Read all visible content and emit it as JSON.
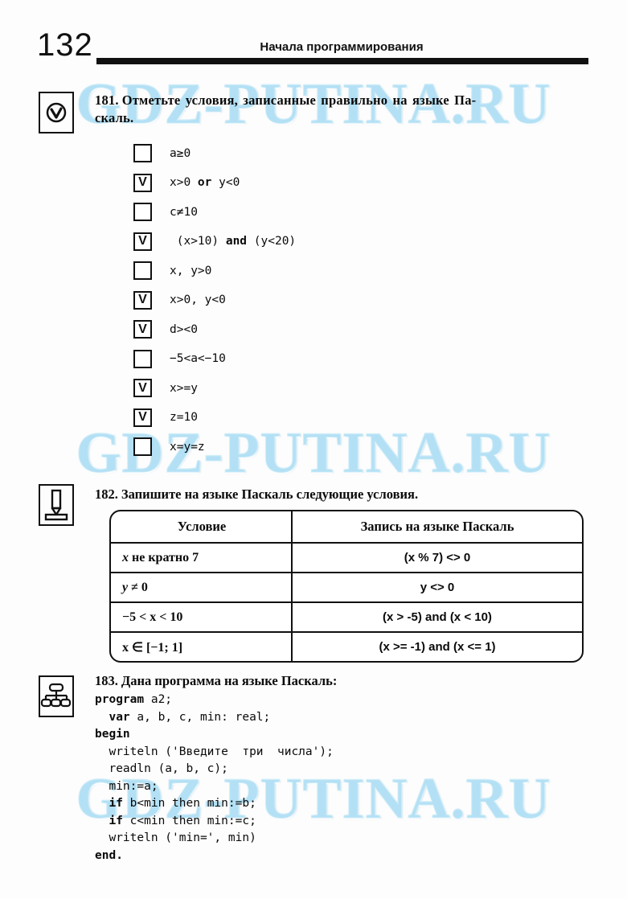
{
  "header": {
    "page_number": "132",
    "running_head": "Начала программирования"
  },
  "watermark": {
    "text": "GDZ-PUTINA.RU",
    "color": "#9fd8f2"
  },
  "icons": {
    "check_icon_name": "check-circle-icon",
    "pencil_icon_name": "pencil-icon",
    "tree_icon_name": "hierarchy-tree-icon"
  },
  "exercise_181": {
    "number": "181.",
    "prompt_line_1": "Отметьте условия, записанные правильно на языке Па-",
    "prompt_line_2": "скаль.",
    "options": [
      {
        "checked": false,
        "text": "a≥0"
      },
      {
        "checked": true,
        "text": "x>0 or y<0",
        "pre": "x>0 ",
        "bold": "or",
        "post": " y<0"
      },
      {
        "checked": false,
        "text": "c≠10"
      },
      {
        "checked": true,
        "text": "(x>10) and (y<20)",
        "pre": " (x>10) ",
        "bold": "and",
        "post": " (y<20)"
      },
      {
        "checked": false,
        "text": "x, y>0"
      },
      {
        "checked": true,
        "text": "x>0, y<0"
      },
      {
        "checked": true,
        "text": "d><0"
      },
      {
        "checked": false,
        "text": "−5<a<−10"
      },
      {
        "checked": true,
        "text": "x>=y"
      },
      {
        "checked": true,
        "text": "z=10"
      },
      {
        "checked": false,
        "text": "x=y=z"
      }
    ]
  },
  "exercise_182": {
    "number": "182.",
    "prompt": "Запишите на языке Паскаль следующие условия.",
    "table": {
      "headers": [
        "Условие",
        "Запись на языке Паскаль"
      ],
      "rows": [
        {
          "condition_italic": "x",
          "condition_rest": " не кратно 7",
          "pascal": "(x % 7) <> 0"
        },
        {
          "condition_italic": "y",
          "condition_rest": " ≠ 0",
          "pascal": "y <> 0"
        },
        {
          "condition_italic": "",
          "condition_rest": "−5 < x < 10",
          "pascal": "(x > -5) and (x < 10)"
        },
        {
          "condition_italic": "",
          "condition_rest": "x ∈ [−1; 1]",
          "pascal": "(x >= -1) and (x <= 1)"
        }
      ]
    }
  },
  "exercise_183": {
    "number": "183.",
    "prompt": "Дана программа на языке Паскаль:",
    "code_lines": [
      {
        "kw": "program",
        "rest": " a2;",
        "indent": ""
      },
      {
        "kw": "var",
        "rest": " a, b, c, min: real;",
        "indent": "  "
      },
      {
        "kw": "begin",
        "rest": "",
        "indent": ""
      },
      {
        "kw": "",
        "rest": "writeln ('Введите  три  числа');",
        "indent": "  "
      },
      {
        "kw": "",
        "rest": "readln (a, b, c);",
        "indent": "  "
      },
      {
        "kw": "",
        "rest": "min:=a;",
        "indent": "  "
      },
      {
        "kw": "if",
        "rest": " b<min then min:=b;",
        "indent": "  "
      },
      {
        "kw": "if",
        "rest": " c<min then min:=c;",
        "indent": "  "
      },
      {
        "kw": "",
        "rest": "writeln ('min=', min)",
        "indent": "  "
      },
      {
        "kw": "end.",
        "rest": "",
        "indent": ""
      }
    ]
  }
}
